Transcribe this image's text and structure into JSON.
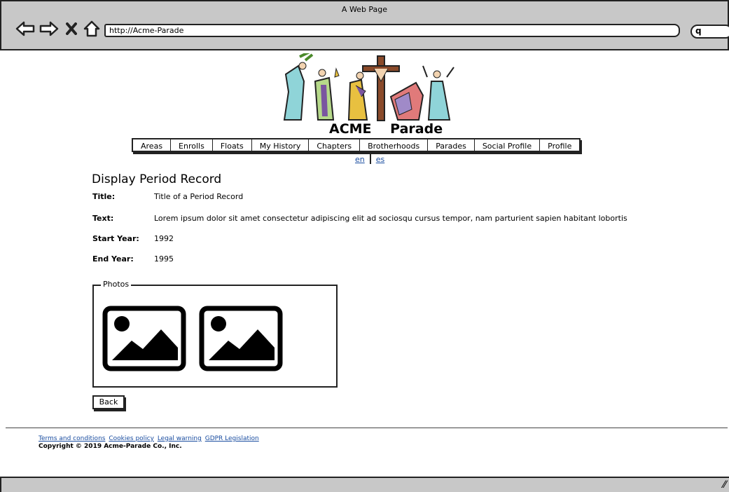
{
  "window": {
    "title": "A Web Page"
  },
  "browser": {
    "url": "http://Acme-Parade",
    "search_icon_glyph": "q"
  },
  "logo": {
    "word1": "ACME",
    "word2": "Parade"
  },
  "menu": {
    "items": [
      "Areas",
      "Enrolls",
      "Floats",
      "My History",
      "Chapters",
      "Brotherhoods",
      "Parades",
      "Social Profile",
      "Profile"
    ]
  },
  "lang": {
    "en": "en",
    "es": "es"
  },
  "record": {
    "heading": "Display Period Record",
    "title_label": "Title:",
    "title_value": "Title of a Period Record",
    "text_label": "Text:",
    "text_value": "Lorem ipsum dolor sit amet consectetur adipiscing elit ad sociosqu cursus tempor, nam parturient sapien habitant lobortis",
    "start_label": "Start Year:",
    "start_value": "1992",
    "end_label": "End Year:",
    "end_value": "1995"
  },
  "photos": {
    "legend": "Photos"
  },
  "back_button": "Back",
  "footer": {
    "links": [
      "Terms and conditions",
      "Cookies policy",
      "Legal warning",
      "GDPR Legislation"
    ],
    "copyright": "Copyright © 2019 Acme-Parade Co., Inc."
  }
}
